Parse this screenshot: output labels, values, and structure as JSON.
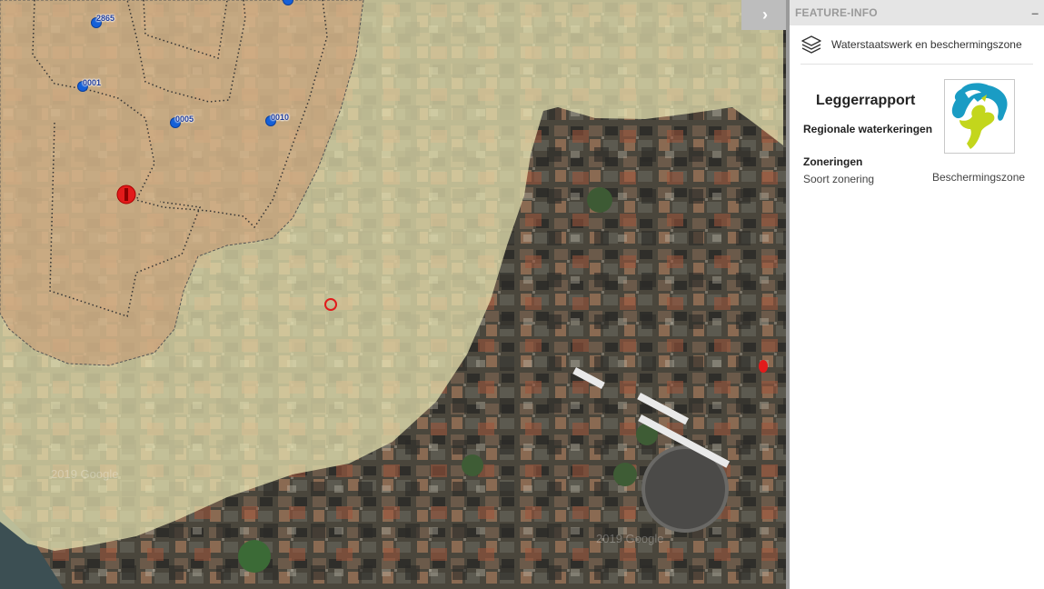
{
  "map": {
    "markers": [
      {
        "label": "2865"
      },
      {
        "label": "0001"
      },
      {
        "label": "0005"
      },
      {
        "label": "0010"
      }
    ],
    "watermarks": [
      "2019 Google",
      "2019 Google"
    ],
    "colors": {
      "zone_fill": "#ece8b4",
      "core_zone_fill": "#d9b49a",
      "marker_blue": "#1560d8",
      "selected_marker": "#e21b1b"
    }
  },
  "toggle": {
    "icon": "chevron-right-icon",
    "glyph": "›"
  },
  "panel": {
    "title": "FEATURE-INFO",
    "minimize_glyph": "–",
    "layer": {
      "icon": "layers-icon",
      "name": "Waterstaatswerk en beschermingszone"
    },
    "report": {
      "title": "Leggerrapport",
      "subtitle": "Regionale waterkeringen",
      "zone_heading": "Zoneringen",
      "zone_type_label": "Soort zonering",
      "zone_type_value": "Beschermingszone"
    }
  }
}
